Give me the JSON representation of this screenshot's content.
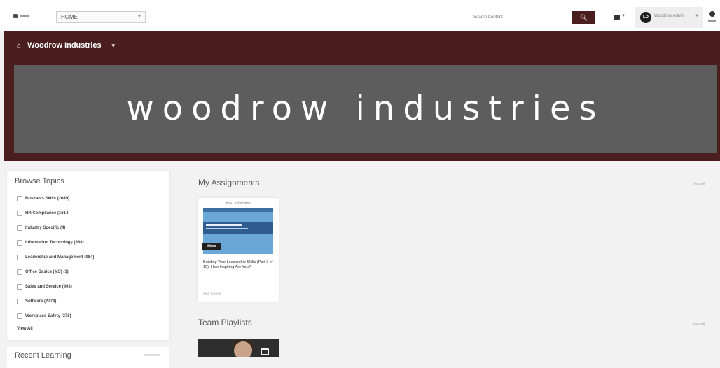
{
  "topbar": {
    "home_select": "HOME",
    "search_placeholder": "Search Content",
    "user_avatar": "LD",
    "user_name": "Woodrow Admin"
  },
  "brand": {
    "menu_label": "Woodrow Industries",
    "banner_title": "woodrow industries",
    "colors": {
      "brand": "#4a1e1e",
      "banner": "#5d5d5d"
    }
  },
  "sidebar": {
    "title": "Browse Topics",
    "topics": [
      "Business Skills (2049)",
      "HR Compliance (1614)",
      "Industry Specific (4)",
      "Information Technology (988)",
      "Leadership and Management (984)",
      "Office Basics (MS) (1)",
      "Sales and Service (493)",
      "Software (2774)",
      "Workplace Safety (378)"
    ],
    "view_all": "View All"
  },
  "recent": {
    "title": "Recent Learning"
  },
  "assignments": {
    "title": "My Assignments",
    "view_all": "View All",
    "card": {
      "due": "Due - 12/30/2020",
      "badge": "Video",
      "title": "Building Your Leadership Skills (Part 3 of 10): How Inspiring Are You?",
      "footer": "Start Course"
    }
  },
  "playlists": {
    "title": "Team Playlists",
    "view_all": "View All"
  }
}
